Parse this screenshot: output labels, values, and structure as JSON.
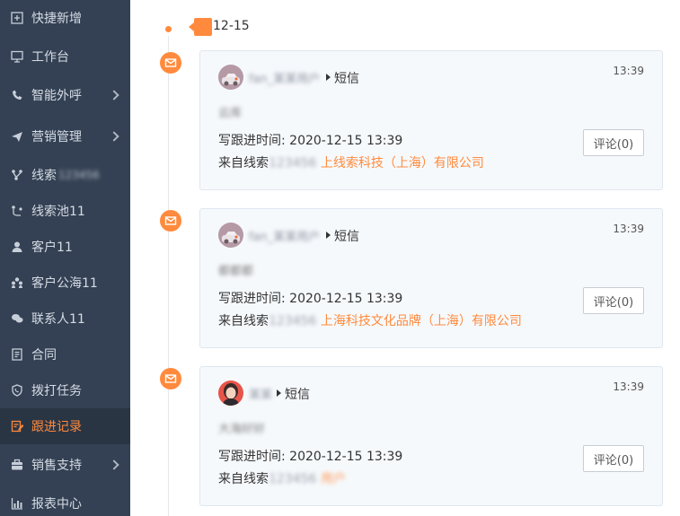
{
  "sidebar": {
    "items": [
      {
        "label": "快捷新增",
        "icon": "plus-square-icon",
        "arrow": false,
        "blur": ""
      },
      {
        "label": "工作台",
        "icon": "monitor-icon",
        "arrow": false,
        "blur": ""
      },
      {
        "label": "智能外呼",
        "icon": "phone-icon",
        "arrow": true,
        "blur": ""
      },
      {
        "label": "营销管理",
        "icon": "send-icon",
        "arrow": true,
        "blur": ""
      },
      {
        "label": "线索",
        "icon": "branch-icon",
        "arrow": false,
        "blur": "123456"
      },
      {
        "label": "线索池11",
        "icon": "pool-icon",
        "arrow": false,
        "blur": ""
      },
      {
        "label": "客户11",
        "icon": "user-icon",
        "arrow": false,
        "blur": ""
      },
      {
        "label": "客户公海11",
        "icon": "users-icon",
        "arrow": false,
        "blur": ""
      },
      {
        "label": "联系人11",
        "icon": "chat-icon",
        "arrow": false,
        "blur": ""
      },
      {
        "label": "合同",
        "icon": "document-icon",
        "arrow": false,
        "blur": ""
      },
      {
        "label": "拨打任务",
        "icon": "phone-task-icon",
        "arrow": false,
        "blur": ""
      },
      {
        "label": "跟进记录",
        "icon": "edit-record-icon",
        "arrow": false,
        "blur": "",
        "active": true
      },
      {
        "label": "销售支持",
        "icon": "briefcase-icon",
        "arrow": true,
        "blur": ""
      },
      {
        "label": "报表中心",
        "icon": "chart-icon",
        "arrow": false,
        "blur": ""
      }
    ]
  },
  "timeline": {
    "date": "12-15",
    "records": [
      {
        "author": "fan_某某用户",
        "type": "短信",
        "time": "13:39",
        "content": "云库",
        "follow_label": "写跟进时间:",
        "follow_time": "2020-12-15 13:39",
        "source_label": "来自线索",
        "source_code": "123456",
        "source_company": "上线索科技（上海）有限公司",
        "comment_label": "评论(0)",
        "avatar": "avatar-car"
      },
      {
        "author": "fan_某某用户",
        "type": "短信",
        "time": "13:39",
        "content": "都都都",
        "follow_label": "写跟进时间:",
        "follow_time": "2020-12-15 13:39",
        "source_label": "来自线索",
        "source_code": "123456",
        "source_company": "上海科技文化品牌（上海）有限公司",
        "comment_label": "评论(0)",
        "avatar": "avatar-car"
      },
      {
        "author": "某某",
        "type": "短信",
        "time": "13:39",
        "content": "大海好好",
        "follow_label": "写跟进时间:",
        "follow_time": "2020-12-15 13:39",
        "source_label": "来自线索",
        "source_code": "123456",
        "source_company": "用户",
        "comment_label": "评论(0)",
        "avatar": "avatar-woman"
      }
    ]
  }
}
